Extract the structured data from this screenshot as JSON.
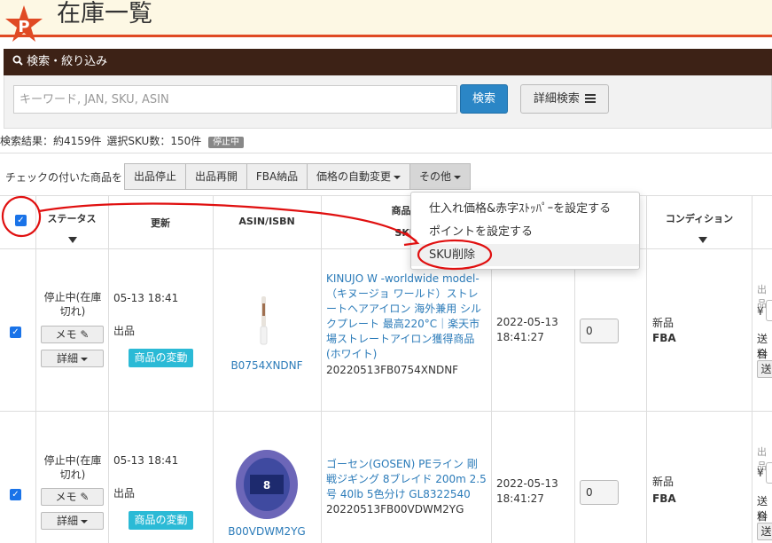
{
  "header": {
    "title": "在庫一覧",
    "accent_color": "#e04a24",
    "bg_color": "#fdf8e4"
  },
  "search": {
    "panel_title": "検索・絞り込み",
    "placeholder": "キーワード, JAN, SKU, ASIN",
    "search_label": "検索",
    "advanced_label": "詳細検索"
  },
  "results": {
    "text": "検索結果：約4159件",
    "selected": "選択SKU数：150件",
    "badge": "停止中"
  },
  "bulk": {
    "label": "チェックの付いた商品を",
    "buttons": [
      "出品停止",
      "出品再開",
      "FBA納品",
      "価格の自動変更",
      "その他"
    ]
  },
  "menu": {
    "items": [
      "仕入れ価格&赤字ｽﾄｯﾊﾟｰを設定する",
      "ポイントを設定する",
      "SKU削除"
    ]
  },
  "columns": {
    "status": "ステータス",
    "updated": "更新",
    "asin": "ASIN/ISBN",
    "product": "商品名",
    "sku": "SKU",
    "condition": "コンディション"
  },
  "rows": [
    {
      "status": "停止中(在庫切れ)",
      "memo": "メモ",
      "detail": "詳細",
      "updated": "05-13 18:41",
      "listing": "出品",
      "change": "商品の変動",
      "asin": "B0754XNDNF",
      "name": "KINUJO W -worldwide model-（キヌージョ ワールド）ストレートヘアアイロン 海外兼用 シルクプレート 最高220°C｜楽天市場ストレートアイロン獲得商品 (ホワイト)",
      "sku": "20220513FB0754XNDNF",
      "date": "2022-05-13",
      "time": "18:41:27",
      "qty": "0",
      "condition": "新品",
      "channel": "FBA",
      "right1": "出品",
      "right2": "¥",
      "right3": "送料",
      "right4": "合計",
      "right5": "送"
    },
    {
      "status": "停止中(在庫切れ)",
      "memo": "メモ",
      "detail": "詳細",
      "updated": "05-13 18:41",
      "listing": "出品",
      "change": "商品の変動",
      "asin": "B00VDWM2YG",
      "name": "ゴーセン(GOSEN) PEライン 剛戦ジギング 8ブレイド 200m 2.5号 40lb 5色分け GL8322540",
      "sku": "20220513FB00VDWM2YG",
      "date": "2022-05-13",
      "time": "18:41:27",
      "qty": "0",
      "condition": "新品",
      "channel": "FBA",
      "right1": "出品",
      "right2": "¥",
      "right3": "送料",
      "right4": "合計",
      "right5": "送"
    }
  ],
  "colors": {
    "link": "#2b7bb9",
    "primary": "#2b86c6",
    "tag": "#2bbad6",
    "panel_head": "#3d2216",
    "annotation": "#e01010"
  }
}
